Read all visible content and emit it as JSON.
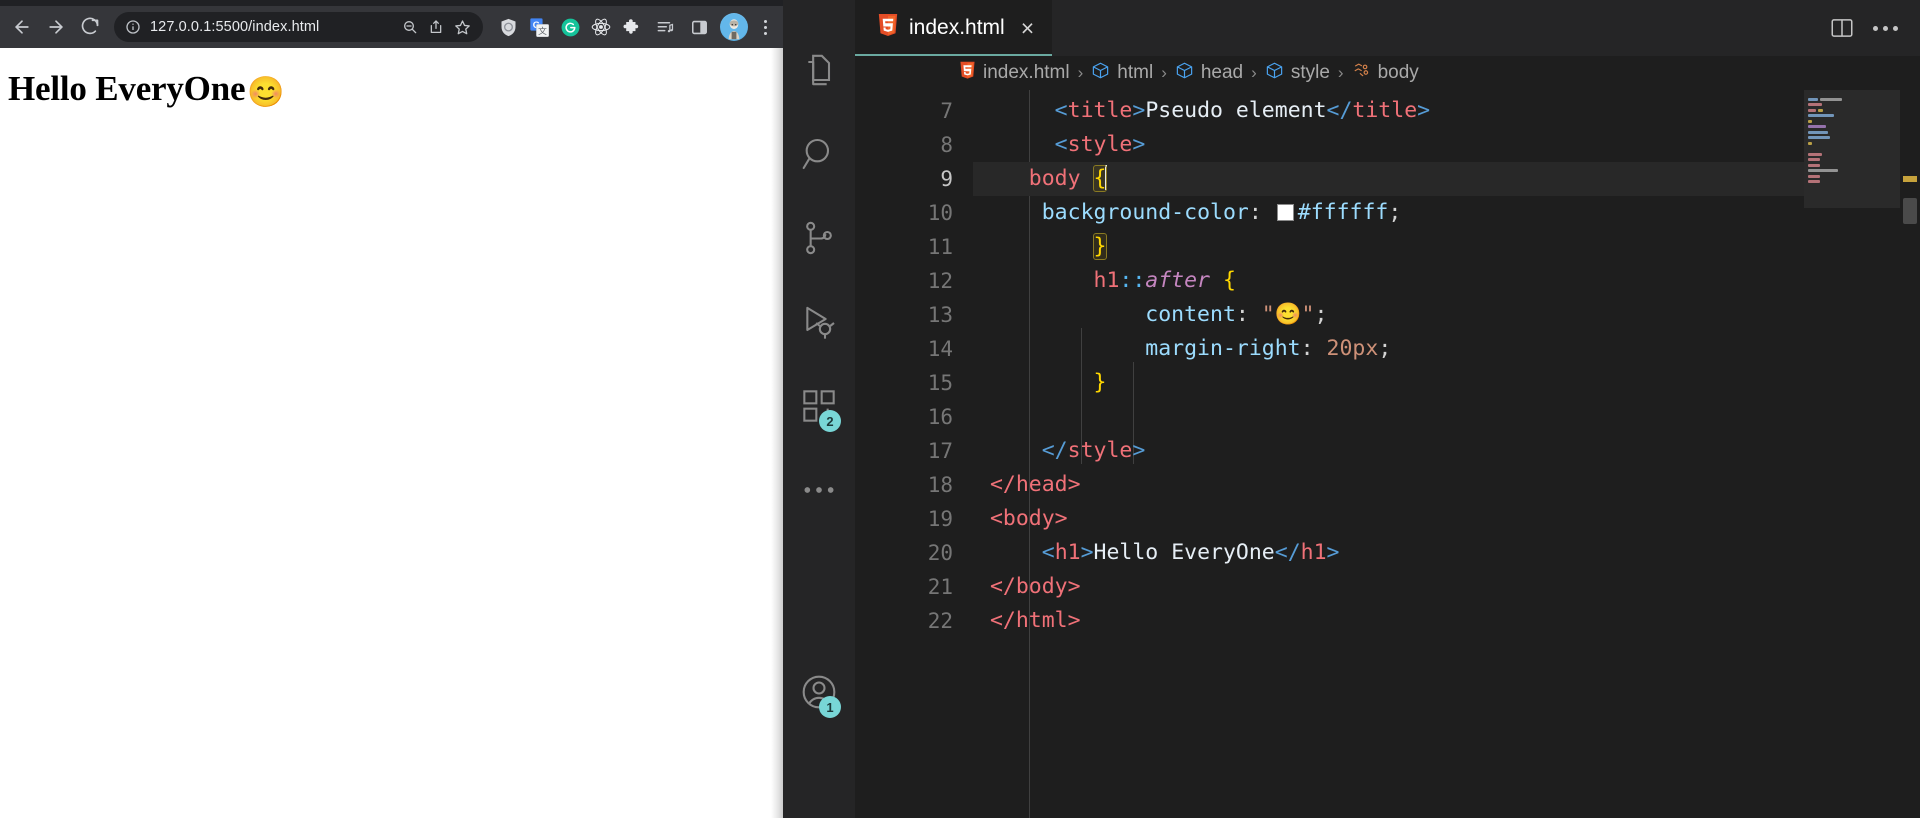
{
  "browser": {
    "url": "127.0.0.1:5500/index.html",
    "nav": {
      "back_label": "Back",
      "forward_label": "Forward",
      "reload_label": "Reload"
    },
    "omnibox": {
      "info_icon": "site-info-icon",
      "zoom_icon": "zoom-out-icon",
      "share_icon": "share-icon",
      "bookmark_icon": "star-icon"
    },
    "extensions": [
      {
        "name": "shield-extension-icon",
        "label": "Shield"
      },
      {
        "name": "google-translate-icon",
        "label": "Google Translate"
      },
      {
        "name": "grammarly-icon",
        "label": "Grammarly"
      },
      {
        "name": "react-devtools-icon",
        "label": "React Developer Tools"
      },
      {
        "name": "puzzle-extensions-icon",
        "label": "Extensions"
      }
    ],
    "reading_list_icon": "reading-list-icon",
    "side_panel_icon": "side-panel-icon",
    "profile_label": "Profile",
    "menu_label": "Customize and control Chrome",
    "page": {
      "heading": "Hello EveryOne",
      "heading_emoji": "😊"
    }
  },
  "vscode": {
    "activitybar": [
      {
        "name": "explorer",
        "icon": "files-icon",
        "badge": ""
      },
      {
        "name": "search",
        "icon": "search-icon",
        "badge": ""
      },
      {
        "name": "source-control",
        "icon": "source-control-icon",
        "badge": ""
      },
      {
        "name": "run-and-debug",
        "icon": "run-debug-icon",
        "badge": ""
      },
      {
        "name": "extensions",
        "icon": "extensions-icon",
        "badge": "2"
      },
      {
        "name": "more-views",
        "icon": "ellipsis-icon",
        "badge": ""
      }
    ],
    "activitybar_bottom": [
      {
        "name": "accounts",
        "icon": "account-icon",
        "badge": "1"
      }
    ],
    "tab": {
      "filename": "index.html",
      "file_icon": "html5-icon",
      "close_label": "×"
    },
    "editor_actions": {
      "split_editor_icon": "split-editor-icon",
      "more_actions_icon": "more-actions-icon"
    },
    "breadcrumbs": [
      {
        "label": "index.html",
        "icon": "html5-icon"
      },
      {
        "label": "html",
        "icon": "symbol-cube-icon"
      },
      {
        "label": "head",
        "icon": "symbol-cube-icon"
      },
      {
        "label": "style",
        "icon": "symbol-cube-icon"
      },
      {
        "label": "body",
        "icon": "symbol-css-icon"
      }
    ],
    "breadcrumb_separator": "›",
    "code": {
      "first_line": 7,
      "active_line": 9,
      "line_numbers": [
        7,
        8,
        9,
        10,
        11,
        12,
        13,
        14,
        15,
        16,
        17,
        18,
        19,
        20,
        21,
        22
      ],
      "lines": [
        {
          "n": 7,
          "text": "        <title>Pseudo element</title>"
        },
        {
          "n": 8,
          "text": "        <style>"
        },
        {
          "n": 9,
          "text": "     body {"
        },
        {
          "n": 10,
          "text": "      background-color: #ffffff;"
        },
        {
          "n": 11,
          "text": "          }"
        },
        {
          "n": 12,
          "text": "          h1::after {"
        },
        {
          "n": 13,
          "text": "              content: \"😊\";"
        },
        {
          "n": 14,
          "text": "              margin-right: 20px;"
        },
        {
          "n": 15,
          "text": "          }"
        },
        {
          "n": 16,
          "text": ""
        },
        {
          "n": 17,
          "text": "      </style>"
        },
        {
          "n": 18,
          "text": "  </head>"
        },
        {
          "n": 19,
          "text": "  <body>"
        },
        {
          "n": 20,
          "text": "      <h1>Hello EveryOne</h1>"
        },
        {
          "n": 21,
          "text": "  </body>"
        },
        {
          "n": 22,
          "text": "  </html>"
        }
      ],
      "tokens": {
        "title_open_lt": "<",
        "title_open_name": "title",
        "title_open_gt": ">",
        "title_content": "Pseudo element",
        "title_close_lt": "</",
        "title_close_name": "title",
        "title_close_gt": ">",
        "style_open_lt": "<",
        "style_open_name": "style",
        "style_open_gt": ">",
        "body_selector": "body",
        "open_brace": "{",
        "prop_background": "background-color",
        "colon": ":",
        "color_value": "#ffffff",
        "semicolon": ";",
        "close_brace": "}",
        "h1_selector": "h1",
        "double_colon": "::",
        "after_pseudo": "after",
        "prop_content": "content",
        "content_value": "\"😊\"",
        "prop_margin": "margin-right",
        "margin_value": "20px",
        "style_close_lt": "</",
        "style_close_name": "style",
        "style_close_gt": ">",
        "head_close": "</head>",
        "body_open": "<body>",
        "h1_open_lt": "<",
        "h1_open_name": "h1",
        "h1_open_gt": ">",
        "h1_text": "Hello EveryOne",
        "h1_close_lt": "</",
        "h1_close_name": "h1",
        "h1_close_gt": ">",
        "body_close": "</body>",
        "html_close": "</html>"
      },
      "colors": {
        "tag": "#f07178",
        "angle": "#569cd6",
        "property": "#9cdcfe",
        "value": "#ce9178",
        "pseudo": "#c586c0",
        "brace": "#ffd700",
        "text": "#e6eef5",
        "swatch": "#ffffff",
        "active_line_bg": "#282828",
        "editor_bg": "#1e1e1e"
      }
    }
  }
}
